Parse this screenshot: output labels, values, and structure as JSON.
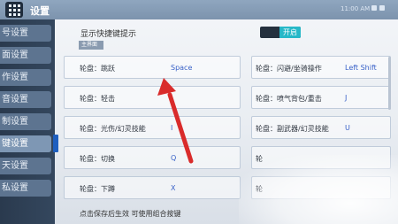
{
  "header": {
    "title": "设置",
    "status_text": "11:00 AM"
  },
  "sidebar": {
    "items": [
      {
        "label": "号设置"
      },
      {
        "label": "面设置"
      },
      {
        "label": "作设置"
      },
      {
        "label": "音设置"
      },
      {
        "label": "制设置"
      },
      {
        "label": "键设置"
      },
      {
        "label": "天设置"
      },
      {
        "label": "私设置"
      }
    ]
  },
  "settings": {
    "show_shortcut_label": "显示快捷键提示",
    "toggle_on": "开启",
    "badge": "主界面",
    "bindings": [
      {
        "label": "轮盘：跳跃",
        "key": "Space"
      },
      {
        "label": "轮盘：闪避/坐骑操作",
        "key": "Left Shift"
      },
      {
        "label": "轮盘：轻击",
        "key": ""
      },
      {
        "label": "轮盘：喷气背包/重击",
        "key": "J"
      },
      {
        "label": "轮盘：光伤/幻灵技能",
        "key": "I"
      },
      {
        "label": "轮盘：副武器/幻灵技能",
        "key": "U"
      },
      {
        "label": "轮盘：切换",
        "key": "Q"
      },
      {
        "label": "轮",
        "key": ""
      },
      {
        "label": "轮盘：下蹲",
        "key": "X"
      },
      {
        "label": "轮",
        "key": ""
      }
    ],
    "hint": "点击保存后生效 可使用组合按键"
  },
  "colors": {
    "accent": "#3a62c8",
    "toggle_on": "#26b8c8",
    "arrow": "#d92b2b"
  }
}
